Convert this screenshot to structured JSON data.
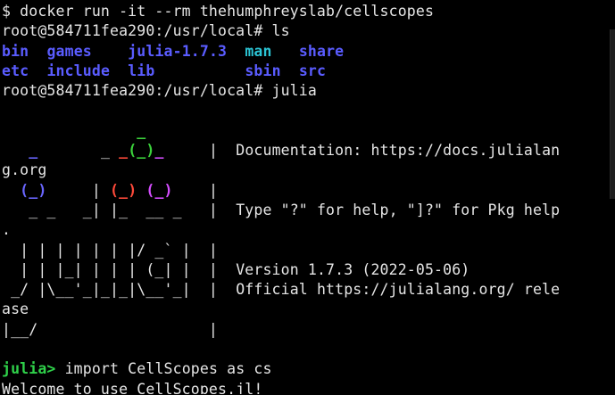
{
  "terminal": {
    "cmd_docker": "$ docker run -it --rm thehumphreyslab/cellscopes",
    "cmd_ls": "root@584711fea290:/usr/local# ls",
    "ls_row1": [
      {
        "pad": "",
        "text": "bin",
        "color": "blue"
      },
      {
        "pad": "  ",
        "text": "games",
        "color": "blue"
      },
      {
        "pad": "    ",
        "text": "julia-1.7.3",
        "color": "blue"
      },
      {
        "pad": "  ",
        "text": "man",
        "color": "cyan"
      },
      {
        "pad": "   ",
        "text": "share",
        "color": "blue"
      }
    ],
    "ls_row2": [
      {
        "pad": "",
        "text": "etc",
        "color": "blue"
      },
      {
        "pad": "  ",
        "text": "include",
        "color": "blue"
      },
      {
        "pad": "  ",
        "text": "lib",
        "color": "blue"
      },
      {
        "pad": "          ",
        "text": "sbin",
        "color": "blue"
      },
      {
        "pad": "  ",
        "text": "src",
        "color": "blue"
      }
    ],
    "cmd_julia": "root@584711fea290:/usr/local# julia",
    "banner": {
      "doc_text": "Documentation: https://docs.julialan",
      "doc_wrap": "g.org",
      "help_text": "Type \"?\" for help, \"]?\" for Pkg help",
      "help_wrap": ".",
      "version_text": "Version 1.7.3 (2022-05-06)",
      "official_text": "Official https://julialang.org/ rele",
      "official_wrap": "ase"
    },
    "julia_prompt": "julia>",
    "julia_command": " import CellScopes as cs",
    "output": "Welcome to use CellScopes.jl!"
  },
  "colors": {
    "background": "#000000",
    "text": "#e6e6e6",
    "directory": "#5a5cff",
    "man_dir": "#2bc4d4",
    "julia_prompt": "#2fd14a",
    "logo_green": "#3bd13b",
    "logo_red": "#ff4a3a",
    "logo_purple": "#d54dff",
    "logo_blue": "#6a66ff"
  }
}
